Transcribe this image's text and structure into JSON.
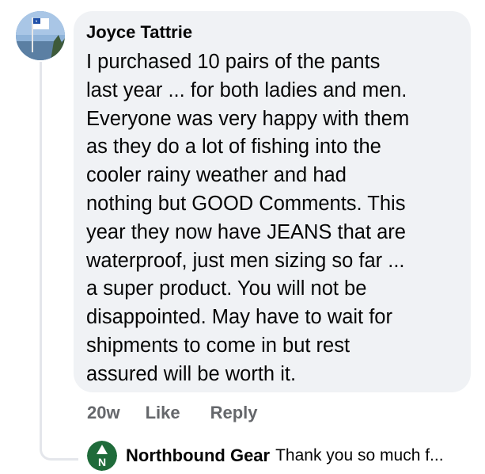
{
  "comment": {
    "author": "Joyce Tattrie",
    "text": "I purchased 10 pairs of the pants\nlast year ... for both ladies and men.\nEveryone was very happy with them\nas they do a lot of fishing into the\ncooler rainy weather and had\nnothing but GOOD Comments.  This\nyear they now have JEANS that are\nwaterproof, just men sizing so far ...\na super product.  You will not be\ndisappointed.  May have to wait for\nshipments to come in but rest\nassured will be worth it.",
    "timestamp": "20w",
    "like_label": "Like",
    "reply_label": "Reply",
    "avatar_icon": "flag-photo-avatar-icon"
  },
  "reply_preview": {
    "author": "Northbound Gear",
    "text": "Thank you so much f...",
    "avatar_letter": "N",
    "avatar_icon": "northbound-gear-logo-icon",
    "brand_color": "#1f6b3a"
  },
  "colors": {
    "bubble": "#f0f2f5",
    "secondary_text": "#65676b",
    "thread_line": "#e4e6eb"
  }
}
